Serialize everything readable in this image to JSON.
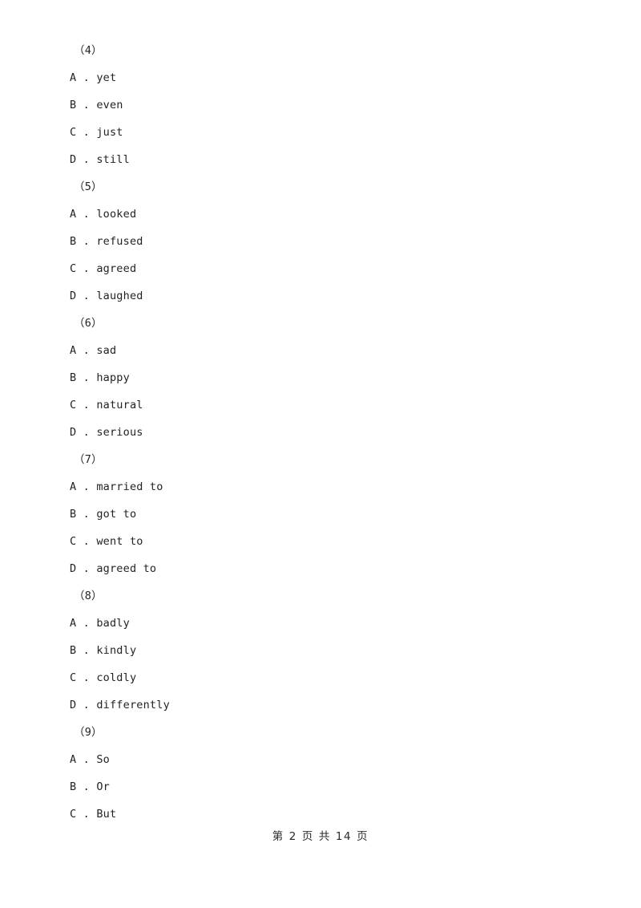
{
  "document": {
    "background_color": "#ffffff",
    "text_color": "#232323",
    "option_separator": " . "
  },
  "question_groups": [
    {
      "label": "（4）",
      "options": [
        {
          "letter": "A",
          "text": "yet"
        },
        {
          "letter": "B",
          "text": "even"
        },
        {
          "letter": "C",
          "text": "just"
        },
        {
          "letter": "D",
          "text": "still"
        }
      ]
    },
    {
      "label": "（5）",
      "options": [
        {
          "letter": "A",
          "text": "looked"
        },
        {
          "letter": "B",
          "text": "refused"
        },
        {
          "letter": "C",
          "text": "agreed"
        },
        {
          "letter": "D",
          "text": "laughed"
        }
      ]
    },
    {
      "label": "（6）",
      "options": [
        {
          "letter": "A",
          "text": "sad"
        },
        {
          "letter": "B",
          "text": "happy"
        },
        {
          "letter": "C",
          "text": "natural"
        },
        {
          "letter": "D",
          "text": "serious"
        }
      ]
    },
    {
      "label": "（7）",
      "options": [
        {
          "letter": "A",
          "text": "married to"
        },
        {
          "letter": "B",
          "text": "got to"
        },
        {
          "letter": "C",
          "text": "went to"
        },
        {
          "letter": "D",
          "text": "agreed to"
        }
      ]
    },
    {
      "label": "（8）",
      "options": [
        {
          "letter": "A",
          "text": "badly"
        },
        {
          "letter": "B",
          "text": "kindly"
        },
        {
          "letter": "C",
          "text": "coldly"
        },
        {
          "letter": "D",
          "text": "differently"
        }
      ]
    },
    {
      "label": "（9）",
      "options": [
        {
          "letter": "A",
          "text": "So"
        },
        {
          "letter": "B",
          "text": "Or"
        },
        {
          "letter": "C",
          "text": "But"
        }
      ]
    }
  ],
  "footer": {
    "text": "第 2 页 共 14 页",
    "current_page": "2",
    "total_pages": "14"
  }
}
